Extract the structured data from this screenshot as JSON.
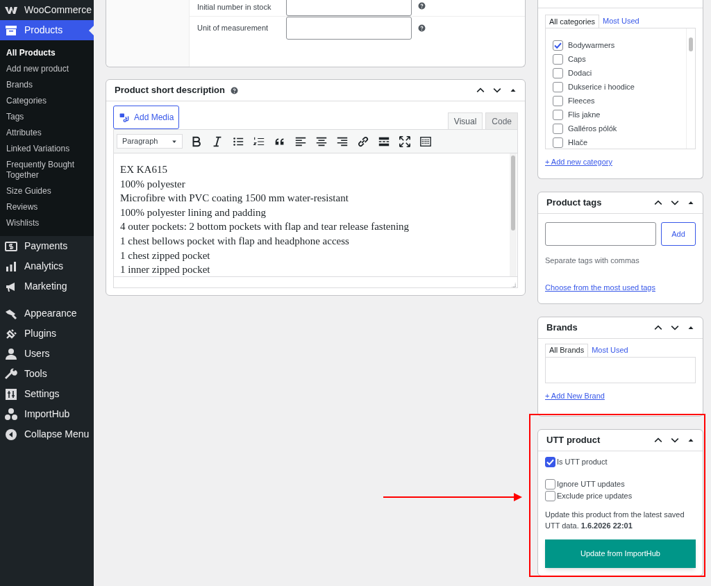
{
  "sidebar": {
    "groups": [
      [
        {
          "label": "WooCommerce",
          "selected": false
        },
        {
          "label": "Products",
          "selected": true,
          "children": [
            {
              "label": "All Products",
              "selected": true
            },
            {
              "label": "Add new product",
              "selected": false
            },
            {
              "label": "Brands",
              "selected": false
            },
            {
              "label": "Categories",
              "selected": false
            },
            {
              "label": "Tags",
              "selected": false
            },
            {
              "label": "Attributes",
              "selected": false
            },
            {
              "label": "Linked Variations",
              "selected": false
            },
            {
              "label": "Frequently Bought Together",
              "selected": false
            },
            {
              "label": "Size Guides",
              "selected": false
            },
            {
              "label": "Reviews",
              "selected": false
            },
            {
              "label": "Wishlists",
              "selected": false
            }
          ]
        },
        {
          "label": "Payments",
          "selected": false
        },
        {
          "label": "Analytics",
          "selected": false
        },
        {
          "label": "Marketing",
          "selected": false
        }
      ],
      [
        {
          "label": "Appearance",
          "selected": false
        },
        {
          "label": "Plugins",
          "selected": false
        },
        {
          "label": "Users",
          "selected": false
        },
        {
          "label": "Tools",
          "selected": false
        },
        {
          "label": "Settings",
          "selected": false
        },
        {
          "label": "ImportHub",
          "selected": false
        },
        {
          "label": "Collapse Menu",
          "selected": false
        }
      ]
    ]
  },
  "inventory": {
    "fields": [
      {
        "label": "Initial number in stock"
      },
      {
        "label": "Unit of measurement"
      }
    ]
  },
  "short_description": {
    "title": "Product short description",
    "add_media": "Add Media",
    "tabs": [
      {
        "label": "Visual",
        "selected": true
      },
      {
        "label": "Code",
        "selected": false
      }
    ],
    "format": "Paragraph",
    "lines": [
      "EX KA615",
      "100% polyester",
      "Microfibre with PVC coating 1500 mm water-resistant",
      "100% polyester lining and padding",
      "4 outer pockets: 2 bottom pockets with flap and tear release fastening",
      "1 chest bellows pocket with flap and headphone access",
      "1 chest zipped pocket",
      "1 inner zipped pocket"
    ]
  },
  "categories": {
    "tabs": [
      {
        "label": "All categories",
        "selected": true
      },
      {
        "label": "Most Used",
        "selected": false
      }
    ],
    "items": [
      {
        "label": "Bodywarmers",
        "checked": true
      },
      {
        "label": "Caps",
        "checked": false
      },
      {
        "label": "Dodaci",
        "checked": false
      },
      {
        "label": "Dukserice i hoodice",
        "checked": false
      },
      {
        "label": "Fleeces",
        "checked": false
      },
      {
        "label": "Flis jakne",
        "checked": false
      },
      {
        "label": "Galléros pólók",
        "checked": false
      },
      {
        "label": "Hlače",
        "checked": false
      }
    ],
    "add_link": "+ Add new category"
  },
  "tags": {
    "title": "Product tags",
    "add_button": "Add",
    "hint": "Separate tags with commas",
    "link": "Choose from the most used tags"
  },
  "brands": {
    "title": "Brands",
    "tabs": [
      {
        "label": "All Brands",
        "selected": true
      },
      {
        "label": "Most Used",
        "selected": false
      }
    ],
    "add_link": "+ Add New Brand"
  },
  "utt": {
    "title": "UTT product",
    "highlighted": true,
    "options": [
      {
        "label": "Is UTT product",
        "checked": true
      },
      {
        "label": "Ignore UTT updates",
        "checked": false
      },
      {
        "label": "Exclude price updates",
        "checked": false
      }
    ],
    "note": "Update this product from the latest saved UTT data. **1.6.2026 22:01**",
    "button": "Update from ImportHub"
  }
}
